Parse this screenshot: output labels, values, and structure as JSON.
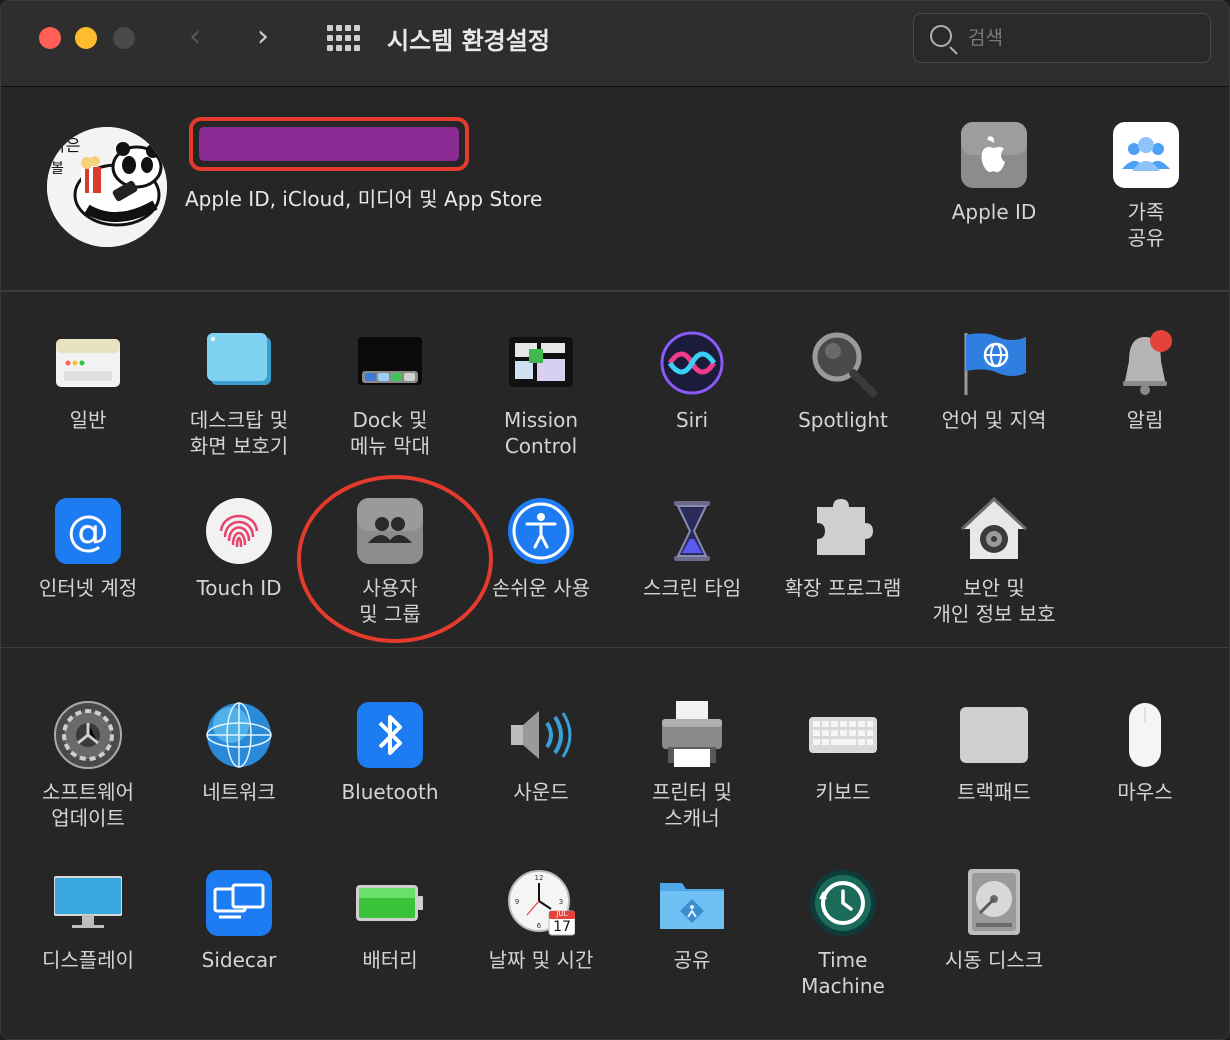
{
  "window": {
    "title": "시스템 환경설정",
    "back_glyph": "‹",
    "forward_glyph": "›"
  },
  "search": {
    "placeholder": "검색",
    "value": ""
  },
  "account": {
    "subtitle": "Apple ID, iCloud, 미디어 및 App Store",
    "apple_id_label": "Apple ID",
    "family_label": "가족\n공유"
  },
  "rows": {
    "row1": [
      "일반",
      "데스크탑 및\n화면 보호기",
      "Dock 및\n메뉴 막대",
      "Mission\nControl",
      "Siri",
      "Spotlight",
      "언어 및 지역",
      "알림"
    ],
    "row2": [
      "인터넷 계정",
      "Touch ID",
      "사용자\n및 그룹",
      "손쉬운 사용",
      "스크린 타임",
      "확장 프로그램",
      "보안 및\n개인 정보 보호"
    ],
    "row3": [
      "소프트웨어\n업데이트",
      "네트워크",
      "Bluetooth",
      "사운드",
      "프린터 및\n스캐너",
      "키보드",
      "트랙패드",
      "마우스"
    ],
    "row4": [
      "디스플레이",
      "Sidecar",
      "배터리",
      "날짜 및 시간",
      "공유",
      "Time\nMachine",
      "시동 디스크"
    ]
  },
  "calendar_icon": {
    "month": "JUL",
    "day": "17"
  },
  "colors": {
    "accent_red": "#e53a2e",
    "name_redaction": "#8a2b93",
    "bluetooth_blue": "#1e7cf2"
  }
}
